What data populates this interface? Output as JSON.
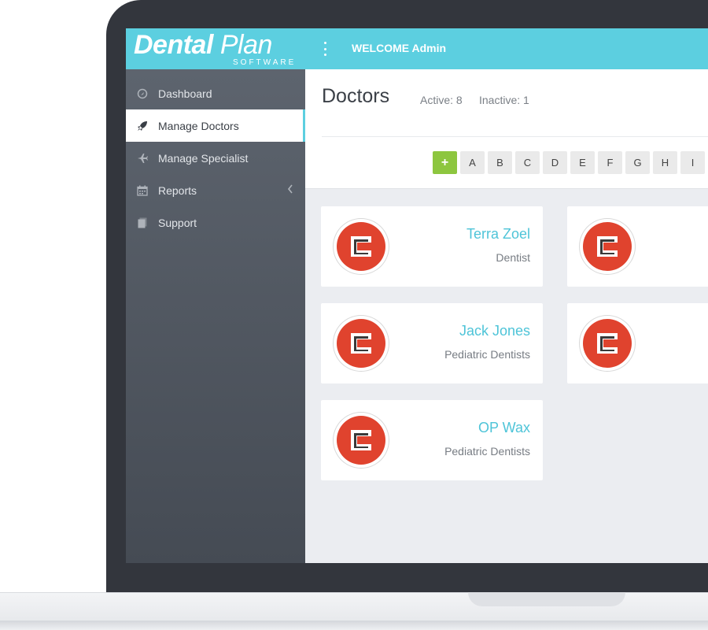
{
  "app": {
    "logo_main": "Dental",
    "logo_plan": "Plan",
    "logo_sub": "SOFTWARE",
    "welcome": "WELCOME Admin"
  },
  "sidebar": {
    "items": [
      {
        "label": "Dashboard",
        "icon": "dashboard-icon",
        "active": false
      },
      {
        "label": "Manage Doctors",
        "icon": "rocket-icon",
        "active": true
      },
      {
        "label": "Manage Specialist",
        "icon": "plane-icon",
        "active": false
      },
      {
        "label": "Reports",
        "icon": "calendar-icon",
        "active": false
      },
      {
        "label": "Support",
        "icon": "files-icon",
        "active": false
      }
    ]
  },
  "page": {
    "title": "Doctors",
    "active_label": "Active: 8",
    "inactive_label": "Inactive: 1"
  },
  "alpha_filter": {
    "add_label": "+",
    "letters": [
      "A",
      "B",
      "C",
      "D",
      "E",
      "F",
      "G",
      "H",
      "I"
    ]
  },
  "doctors": [
    {
      "name": "Terra Zoel",
      "specialty": "Dentist"
    },
    {
      "name": "",
      "specialty": ""
    },
    {
      "name": "Jack Jones",
      "specialty": "Pediatric Dentists"
    },
    {
      "name": "",
      "specialty": ""
    },
    {
      "name": "OP Wax",
      "specialty": "Pediatric Dentists"
    }
  ],
  "colors": {
    "accent": "#5ccfe0",
    "sidebar": "#4f555e",
    "add_button": "#8dc63f",
    "avatar_red": "#e0432e",
    "doctor_name": "#4ec4d8"
  }
}
